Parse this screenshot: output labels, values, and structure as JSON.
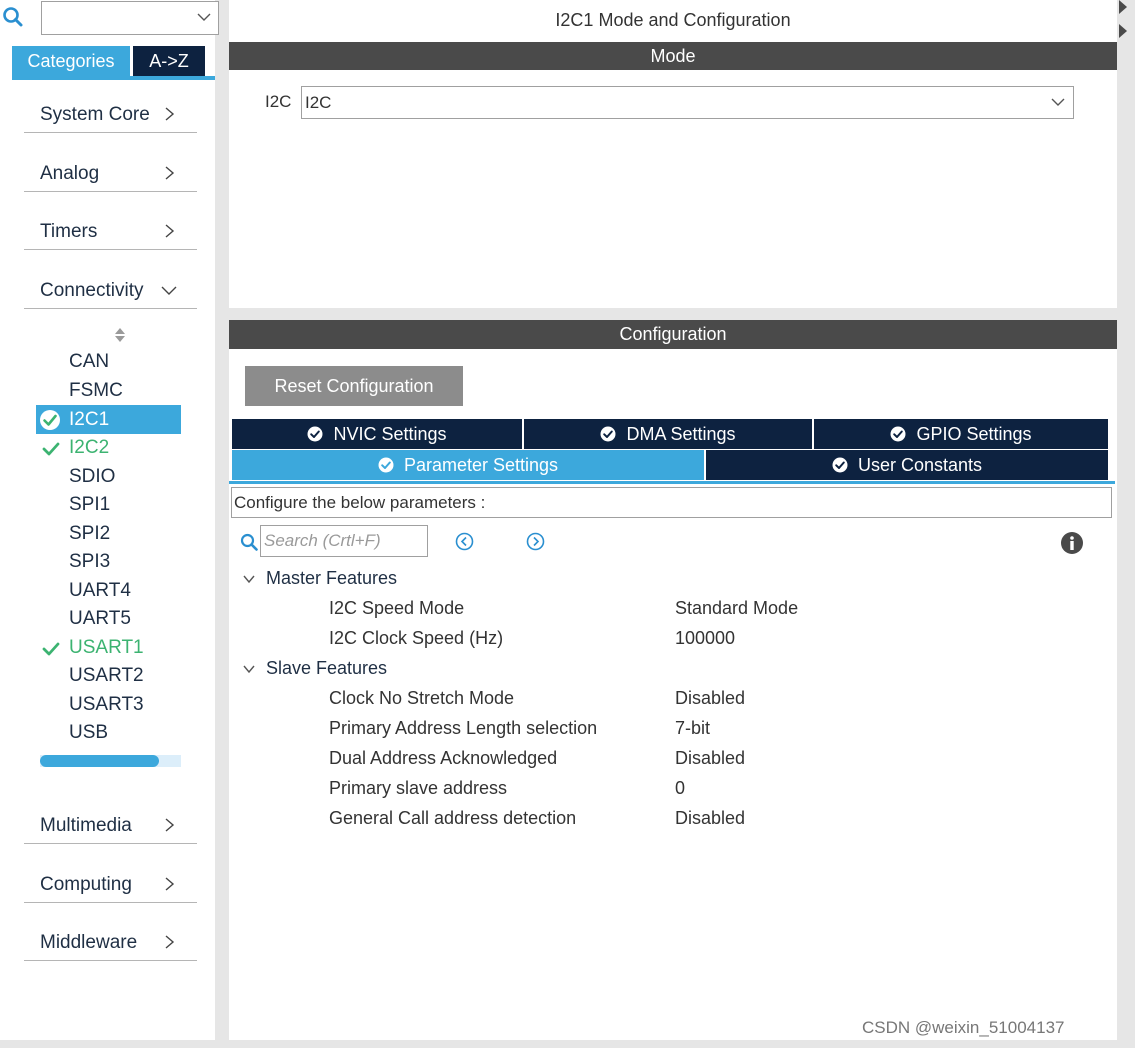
{
  "sidebar": {
    "tabs": {
      "categories": "Categories",
      "atoz": "A->Z"
    },
    "categories": [
      {
        "label": "System Core",
        "expanded": false
      },
      {
        "label": "Analog",
        "expanded": false
      },
      {
        "label": "Timers",
        "expanded": false
      },
      {
        "label": "Connectivity",
        "expanded": true
      }
    ],
    "connectivity_items": [
      {
        "label": "CAN",
        "status": "none"
      },
      {
        "label": "FSMC",
        "status": "none"
      },
      {
        "label": "I2C1",
        "status": "selected"
      },
      {
        "label": "I2C2",
        "status": "configured"
      },
      {
        "label": "SDIO",
        "status": "none"
      },
      {
        "label": "SPI1",
        "status": "none"
      },
      {
        "label": "SPI2",
        "status": "none"
      },
      {
        "label": "SPI3",
        "status": "none"
      },
      {
        "label": "UART4",
        "status": "none"
      },
      {
        "label": "UART5",
        "status": "none"
      },
      {
        "label": "USART1",
        "status": "configured"
      },
      {
        "label": "USART2",
        "status": "none"
      },
      {
        "label": "USART3",
        "status": "none"
      },
      {
        "label": "USB",
        "status": "none"
      }
    ],
    "categories_bottom": [
      {
        "label": "Multimedia",
        "expanded": false
      },
      {
        "label": "Computing",
        "expanded": false
      },
      {
        "label": "Middleware",
        "expanded": false
      }
    ]
  },
  "main": {
    "title": "I2C1 Mode and Configuration",
    "mode_header": "Mode",
    "mode_label": "I2C",
    "mode_value": "I2C",
    "config_header": "Configuration",
    "reset_button": "Reset Configuration",
    "tabs_row1": [
      "NVIC Settings",
      "DMA Settings",
      "GPIO Settings"
    ],
    "tabs_row2": [
      "Parameter Settings",
      "User Constants"
    ],
    "active_tab": "Parameter Settings",
    "param_desc": "Configure the below parameters :",
    "search_placeholder": "Search (Crtl+F)",
    "groups": [
      {
        "name": "Master Features",
        "params": [
          {
            "name": "I2C Speed Mode",
            "value": "Standard Mode"
          },
          {
            "name": "I2C Clock Speed (Hz)",
            "value": "100000"
          }
        ]
      },
      {
        "name": "Slave Features",
        "params": [
          {
            "name": "Clock No Stretch Mode",
            "value": "Disabled"
          },
          {
            "name": "Primary Address Length selection",
            "value": "7-bit"
          },
          {
            "name": "Dual Address Acknowledged",
            "value": "Disabled"
          },
          {
            "name": "Primary slave address",
            "value": "0"
          },
          {
            "name": "General Call address detection",
            "value": "Disabled"
          }
        ]
      }
    ]
  },
  "watermark": "CSDN @weixin_51004137",
  "colors": {
    "accent": "#3ca8dc",
    "navy": "#0d2240",
    "header_gray": "#4a4a4a",
    "configured_green": "#3cb371"
  },
  "icons": {
    "search": "search-icon",
    "chevron_right": "chevron-right-icon",
    "chevron_down": "chevron-down-icon",
    "check": "check-icon",
    "check_circle": "check-circle-icon",
    "info": "info-icon",
    "prev": "prev-arrow-icon",
    "next": "next-arrow-icon",
    "sort": "sort-icon"
  }
}
